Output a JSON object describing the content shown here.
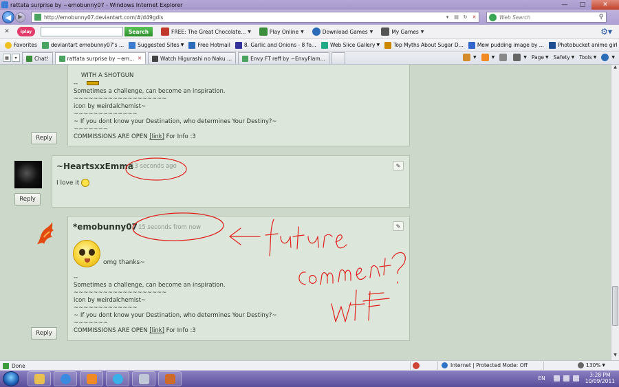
{
  "window": {
    "title": "rattata surprise by ~emobunny07 - Windows Internet Explorer",
    "minimize": "—",
    "maximize": "□",
    "close": "✕"
  },
  "address": {
    "url": "http://emobunny07.deviantart.com/#/d49gdis",
    "search_placeholder": "Web Search"
  },
  "toolbar": {
    "search_button": "Search",
    "items": [
      {
        "label": "FREE: The Great Chocolate...",
        "icon": "gift-icon",
        "color": "#c0392b"
      },
      {
        "label": "Play Online",
        "icon": "play-icon",
        "color": "#3c8d3c"
      },
      {
        "label": "Download Games",
        "icon": "download-icon",
        "color": "#2a6cb8"
      },
      {
        "label": "My Games",
        "icon": "gamepad-icon",
        "color": "#555555"
      }
    ]
  },
  "favorites": {
    "label": "Favorites",
    "items": [
      {
        "label": "deviantart emobunny07's ...",
        "color": "#4aa35e",
        "dd": false
      },
      {
        "label": "Suggested Sites",
        "color": "#3b7bd0",
        "dd": true
      },
      {
        "label": "Free Hotmail",
        "color": "#2a6cb8",
        "dd": false
      },
      {
        "label": "8. Garlic and Onions - 8 fo...",
        "color": "#333399",
        "dd": false
      },
      {
        "label": "Web Slice Gallery",
        "color": "#22aa88",
        "dd": true
      },
      {
        "label": "Top Myths About Sugar D...",
        "color": "#cc8800",
        "dd": false
      },
      {
        "label": "Mew pudding image by ...",
        "color": "#3366cc",
        "dd": false
      },
      {
        "label": "Photobucket  anime girl P...",
        "color": "#1d4f91",
        "dd": false
      }
    ]
  },
  "tabs": [
    {
      "label": "Chat!",
      "color": "#3c8d3c",
      "active": false
    },
    {
      "label": "rattata surprise by ~em...",
      "color": "#4aa35e",
      "active": true
    },
    {
      "label": "Watch Higurashi no Naku ...",
      "color": "#444444",
      "active": false
    },
    {
      "label": "Envy FT reff by ~EnvyFlam...",
      "color": "#4aa35e",
      "active": false
    }
  ],
  "commandbar": {
    "page": "Page",
    "safety": "Safety",
    "tools": "Tools"
  },
  "signature": {
    "dashes": "--",
    "line1": "Sometimes a challenge, can become an inspiration.",
    "tildes1": "~~~~~~~~~~~~~~~~~~~",
    "line2": "icon by weirdalchemist~",
    "tildes2": "~~~~~~~~~~~~~",
    "line3": "~ If you dont know your Destination, who determines Your Destiny?~",
    "tildes3": "~~~~~~~",
    "commissions": "COMMISSIONS ARE OPEN",
    "link": "[link]",
    "info": "For Info :3"
  },
  "comments": {
    "top_partial_text": "WITH A SHOTGUN",
    "reply_label": "Reply",
    "comment2": {
      "username": "~HeartsxxEmma",
      "timestamp": "13 seconds ago",
      "text": "I love it"
    },
    "comment3": {
      "username": "*emobunny07",
      "timestamp": "15 seconds from now",
      "text": "omg thanks~"
    },
    "edit_icon": "✎"
  },
  "annotation": {
    "color": "#e0201c"
  },
  "statusbar": {
    "done": "Done",
    "zone": "Internet | Protected Mode: Off",
    "zoom": "130%"
  },
  "taskbar": {
    "lang": "EN",
    "time": "3:28 PM",
    "date": "10/09/2011"
  }
}
